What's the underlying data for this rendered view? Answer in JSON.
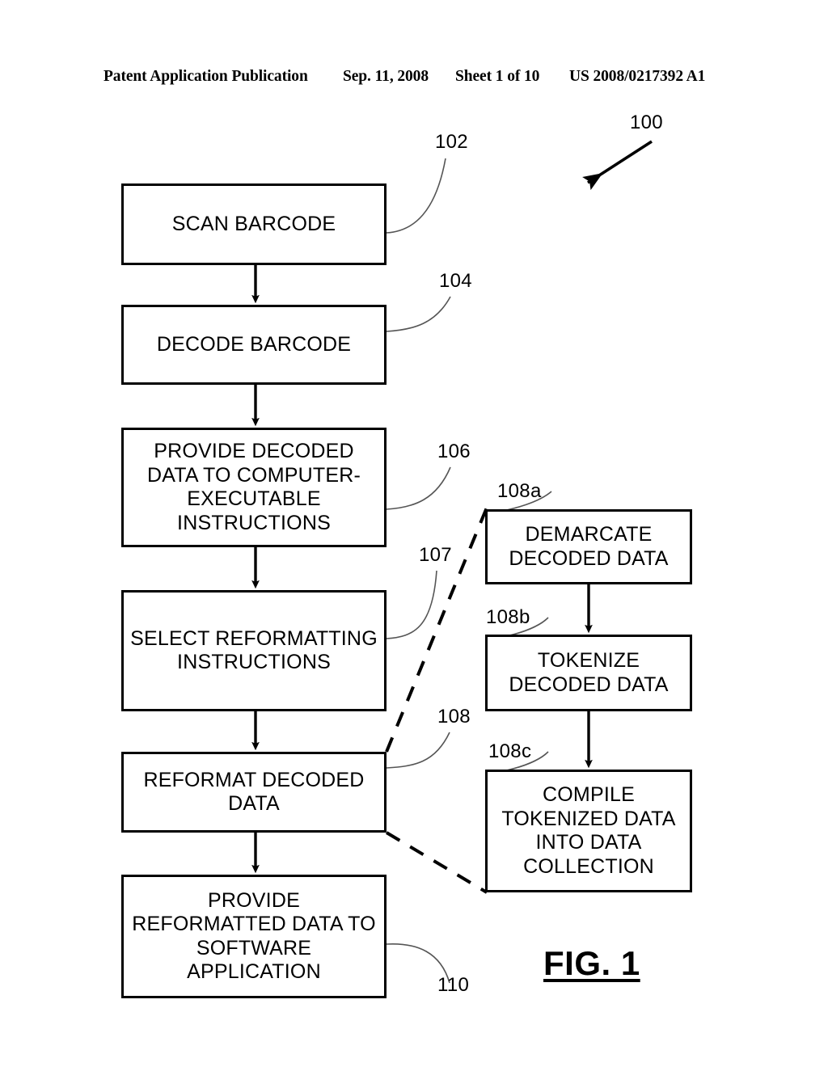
{
  "header": {
    "publication": "Patent Application Publication",
    "date": "Sep. 11, 2008",
    "sheet": "Sheet 1 of 10",
    "patent_number": "US 2008/0217392 A1"
  },
  "figure": {
    "caption": "FIG. 1",
    "system_ref": "100"
  },
  "flowchart": {
    "main_steps": [
      {
        "ref": "102",
        "text": "SCAN BARCODE"
      },
      {
        "ref": "104",
        "text": "DECODE BARCODE"
      },
      {
        "ref": "106",
        "text": "PROVIDE DECODED DATA TO COMPUTER-EXECUTABLE INSTRUCTIONS"
      },
      {
        "ref": "107",
        "text": "SELECT REFORMATTING INSTRUCTIONS"
      },
      {
        "ref": "108",
        "text": "REFORMAT DECODED DATA"
      },
      {
        "ref": "110",
        "text": "PROVIDE REFORMATTED DATA TO SOFTWARE APPLICATION"
      }
    ],
    "sub_steps": [
      {
        "ref": "108a",
        "text": "DEMARCATE DECODED DATA"
      },
      {
        "ref": "108b",
        "text": "TOKENIZE DECODED DATA"
      },
      {
        "ref": "108c",
        "text": "COMPILE TOKENIZED DATA INTO DATA COLLECTION"
      }
    ]
  },
  "colors": {
    "ink": "#000000",
    "paper": "#ffffff",
    "leader": "#555555"
  }
}
